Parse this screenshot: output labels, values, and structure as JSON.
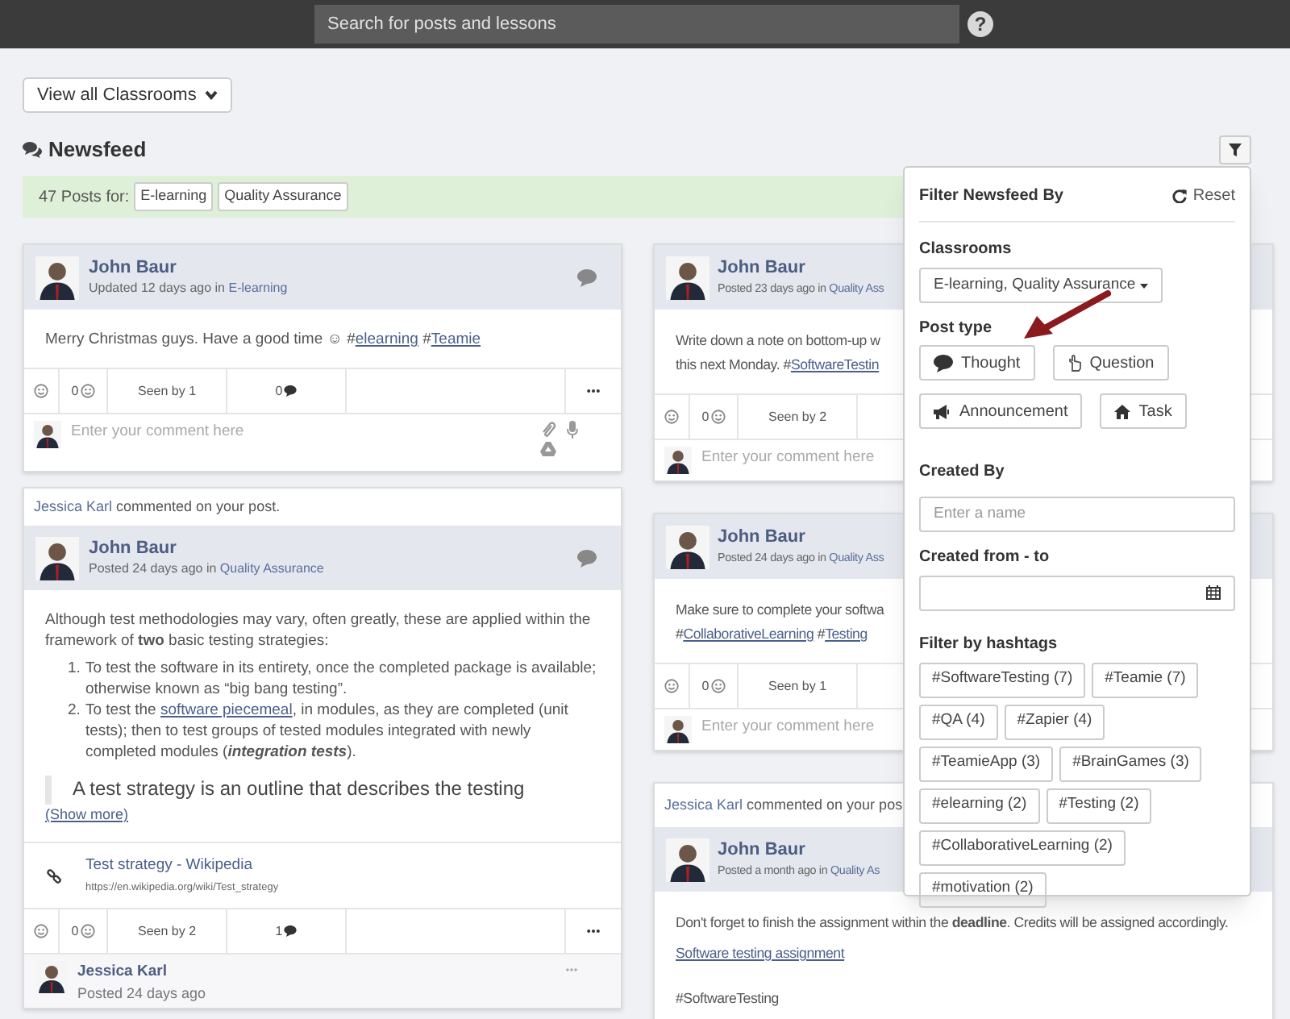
{
  "search": {
    "placeholder": "Search for posts and lessons"
  },
  "help": "?",
  "classroom_button": "View all Classrooms",
  "heading": "Newsfeed",
  "summary": {
    "label": "47 Posts for:",
    "tags": [
      "E-learning",
      "Quality Assurance"
    ]
  },
  "columns": [
    [
      {
        "author": "John Baur",
        "meta": "Updated 12 days ago in",
        "classroom": "E-learning",
        "comment_icon": true,
        "body": [
          {
            "kind": "paragraph",
            "lines": [
              [
                {
                  "text": "Merry Christmas guys. Have a good time ☺ #"
                },
                {
                  "text": "elearning",
                  "link": true
                },
                {
                  "text": " #"
                },
                {
                  "text": "Teamie",
                  "link": true
                }
              ]
            ]
          }
        ],
        "actions": {
          "likes": "0",
          "seen": "Seen by 1",
          "comments": "0"
        },
        "comment_box": {
          "placeholder": "Enter your comment here",
          "attachment_icons": true
        }
      },
      {
        "notice": {
          "actor": "Jessica Karl",
          "text": "commented on your post."
        },
        "author": "John Baur",
        "meta": "Posted 24 days ago in",
        "classroom": "Quality Assurance",
        "comment_icon": true,
        "body": [
          {
            "kind": "paragraph",
            "lines": [
              [
                {
                  "text": "Although test methodologies may vary, often greatly, these are applied within the framework of **two** basic testing strategies:"
                }
              ]
            ]
          },
          {
            "kind": "list",
            "items": [
              {
                "number": "1.",
                "parts": [
                  {
                    "text": "To test the software in its entirety, once the completed package is available; otherwise known as “big bang testing”."
                  }
                ]
              },
              {
                "number": "2.",
                "parts": [
                  {
                    "text": "To test the "
                  },
                  {
                    "text": "software piecemeal",
                    "link": true
                  },
                  {
                    "text": ", in modules, as they are completed (unit tests); then to test groups of tested modules integrated with newly completed modules ("
                  },
                  {
                    "kind": "emphasis",
                    "text": "integration tests"
                  },
                  {
                    "text": ")."
                  }
                ]
              }
            ]
          },
          {
            "kind": "quote",
            "text": "A test strategy is an outline that describes the testing"
          },
          {
            "kind": "show_more",
            "text": "(Show more)"
          }
        ],
        "link_preview": {
          "title": "Test strategy - Wikipedia",
          "url": "https://en.wikipedia.org/wiki/Test_strategy"
        },
        "actions": {
          "likes": "0",
          "seen": "Seen by 2",
          "comments": "1"
        },
        "comments": [
          {
            "author": "Jessica Karl",
            "meta": "Posted 24 days ago"
          }
        ]
      }
    ],
    [
      {
        "author": "John Baur",
        "meta": "Posted 23 days ago in",
        "classroom": "Quality Ass",
        "body": [
          {
            "kind": "paragraph",
            "lines": [
              [
                {
                  "text": "Write down a note on bottom-up w"
                }
              ],
              [
                {
                  "text": "this next Monday. #"
                },
                {
                  "text": "SoftwareTestin",
                  "link": true
                }
              ]
            ]
          }
        ],
        "actions": {
          "likes": "0",
          "seen": "Seen by 2"
        },
        "comment_box": {
          "placeholder": "Enter your comment here"
        }
      },
      {
        "author": "John Baur",
        "meta": "Posted 24 days ago in",
        "classroom": "Quality Ass",
        "body": [
          {
            "kind": "paragraph",
            "lines": [
              [
                {
                  "text": "Make sure to complete your softwa"
                }
              ],
              [
                {
                  "text": "#"
                },
                {
                  "text": "CollaborativeLearning",
                  "link": true
                },
                {
                  "text": " #"
                },
                {
                  "text": "Testing",
                  "link": true
                }
              ]
            ]
          }
        ],
        "actions": {
          "likes": "0",
          "seen": "Seen by 1"
        },
        "comment_box": {
          "placeholder": "Enter your comment here"
        }
      },
      {
        "notice": {
          "actor": "Jessica Karl",
          "text": "commented on your pos"
        },
        "author": "John Baur",
        "meta": "Posted a month ago in",
        "classroom": "Quality As",
        "body": [
          {
            "kind": "paragraph",
            "lines": [
              [
                {
                  "text": "Don't forget to finish the assignment within the **deadline**. Credits will be assigned accordingly."
                }
              ]
            ]
          },
          {
            "kind": "link",
            "text": "Software testing assignment"
          },
          {
            "kind": "paragraph",
            "lines": [
              [
                {
                  "text": "#SoftwareTesting"
                }
              ]
            ]
          }
        ]
      }
    ]
  ],
  "filter": {
    "title": "Filter Newsfeed By",
    "reset": "Reset",
    "classrooms_label": "Classrooms",
    "classrooms_value": "E-learning, Quality Assurance",
    "post_type_label": "Post type",
    "post_types": [
      {
        "kind": "thought",
        "label": "Thought"
      },
      {
        "kind": "question",
        "label": "Question"
      },
      {
        "kind": "announcement",
        "label": "Announcement"
      },
      {
        "kind": "task",
        "label": "Task"
      }
    ],
    "created_by_label": "Created By",
    "created_by_placeholder": "Enter a name",
    "date_label": "Created from - to",
    "hashtags_label": "Filter by hashtags",
    "hashtags": [
      "#SoftwareTesting (7)",
      "#Teamie (7)",
      "#QA (4)",
      "#Zapier (4)",
      "#TeamieApp (3)",
      "#BrainGames (3)",
      "#elearning (2)",
      "#Testing (2)",
      "#CollaborativeLearning (2)",
      "#motivation (2)"
    ]
  }
}
